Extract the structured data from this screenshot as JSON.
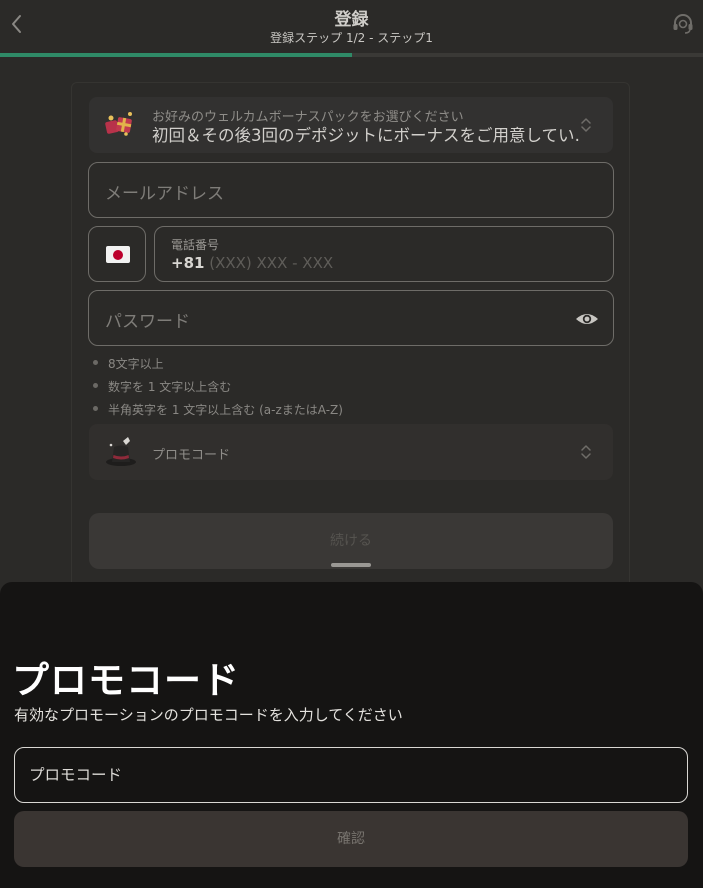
{
  "header": {
    "title": "登録",
    "subtitle": "登録ステップ 1/2 - ステップ1",
    "progress": 0.5
  },
  "form": {
    "bonus": {
      "label": "お好みのウェルカムボーナスパックをお選びください",
      "value": "初回＆その後3回のデポジットにボーナスをご用意してい…"
    },
    "email_placeholder": "メールアドレス",
    "phone": {
      "country_flag": "japan-flag-icon",
      "label": "電話番号",
      "code": "+81",
      "mask": " (XXX) XXX - XXX"
    },
    "password_placeholder": "パスワード",
    "password_rules": [
      "8文字以上",
      "数字を 1 文字以上含む",
      "半角英字を 1 文字以上含む (a-zまたはA-Z)"
    ],
    "promo_select_label": "プロモコード",
    "next_button": "続ける"
  },
  "sheet": {
    "title": "プロモコード",
    "description": "有効なプロモーションのプロモコードを入力してください",
    "input_placeholder": "プロモコード",
    "input_value": "",
    "confirm_button": "確認"
  },
  "colors": {
    "background": "#2b2a28",
    "sheet": "#151413",
    "progress": "#2f8a67",
    "flag_red": "#bc002d"
  }
}
